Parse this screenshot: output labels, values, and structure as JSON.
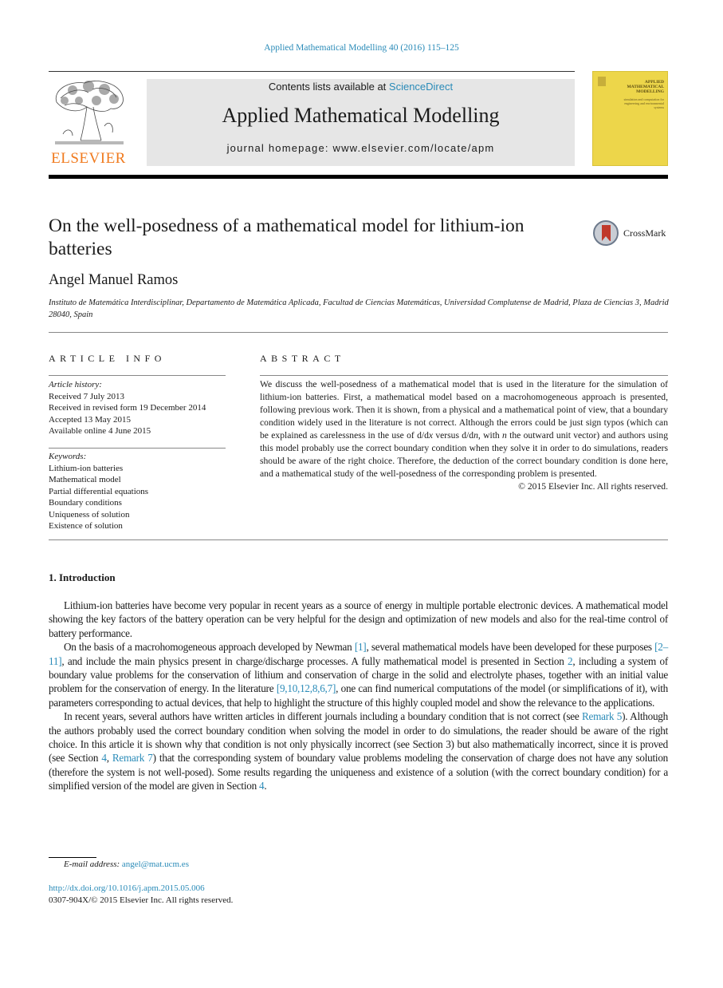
{
  "header": {
    "journal_reference": "Applied Mathematical Modelling 40 (2016) 115–125",
    "contents_prefix": "Contents lists available at ",
    "contents_link": "ScienceDirect",
    "journal_title": "Applied Mathematical Modelling",
    "homepage_line": "journal homepage: www.elsevier.com/locate/apm",
    "publisher_logo_text": "ELSEVIER",
    "cover_title": "APPLIED MATHEMATICAL MODELLING",
    "cover_subtitle": "simulation and computation for engineering and environmental systems",
    "brand_color": "#f07a1e",
    "link_color": "#2a8bb8",
    "cover_color": "#edd64a"
  },
  "article": {
    "title": "On the well-posedness of a mathematical model for lithium-ion batteries",
    "crossmark_label": "CrossMark",
    "author": "Angel Manuel Ramos",
    "affiliation": "Instituto de Matemática Interdisciplinar, Departamento de Matemática Aplicada, Facultad de Ciencias Matemáticas, Universidad Complutense de Madrid, Plaza de Ciencias 3, Madrid 28040, Spain"
  },
  "article_info": {
    "heading": "ARTICLE INFO",
    "history_label": "Article history:",
    "history": [
      "Received 7 July 2013",
      "Received in revised form 19 December 2014",
      "Accepted 13 May 2015",
      "Available online 4 June 2015"
    ],
    "keywords_label": "Keywords:",
    "keywords": [
      "Lithium-ion batteries",
      "Mathematical model",
      "Partial differential equations",
      "Boundary conditions",
      "Uniqueness of solution",
      "Existence of solution"
    ]
  },
  "abstract": {
    "heading": "ABSTRACT",
    "text_1": "We discuss the well-posedness of a mathematical model that is used in the literature for the simulation of lithium-ion batteries. First, a mathematical model based on a macrohomogeneous approach is presented, following previous work. Then it is shown, from a physical and a mathematical point of view, that a boundary condition widely used in the literature is not correct. Although the errors could be just sign typos (which can be explained as carelessness in the use of d/d",
    "var_x": "x",
    "text_2": " versus d/d",
    "var_n": "n",
    "text_3": ", with ",
    "var_n2": "n",
    "text_4": " the outward unit vector) and authors using this model probably use the correct boundary condition when they solve it in order to do simulations, readers should be aware of the right choice. Therefore, the deduction of the correct boundary condition is done here, and a mathematical study of the well-posedness of the corresponding problem is presented.",
    "copyright": "© 2015 Elsevier Inc. All rights reserved."
  },
  "introduction": {
    "heading": "1. Introduction",
    "p1": "Lithium-ion batteries have become very popular in recent years as a source of energy in multiple portable electronic devices. A mathematical model showing the key factors of the battery operation can be very helpful for the design and optimization of new models and also for the real-time control of battery performance.",
    "p2_a": "On the basis of a macrohomogeneous approach developed by Newman ",
    "p2_ref1": "[1]",
    "p2_b": ", several mathematical models have been developed for these purposes ",
    "p2_ref2": "[2–11]",
    "p2_c": ", and include the main physics present in charge/discharge processes. A fully mathematical model is presented in Section ",
    "p2_ref3": "2",
    "p2_d": ", including a system of boundary value problems for the conservation of lithium and conservation of charge in the solid and electrolyte phases, together with an initial value problem for the conservation of energy. In the literature ",
    "p2_ref4": "[9,10,12,8,6,7]",
    "p2_e": ", one can find numerical computations of the model (or simplifications of it), with parameters corresponding to actual devices, that help to highlight the structure of this highly coupled model and show the relevance to the applications.",
    "p3_a": "In recent years, several authors have written articles in different journals including a boundary condition that is not correct (see ",
    "p3_ref1": "Remark 5",
    "p3_b": "). Although the authors probably used the correct boundary condition when solving the model in order to do simulations, the reader should be aware of the right choice. In this article it is shown why that condition is not only physically incorrect (see Section 3) but also mathematically incorrect, since it is proved (see Section ",
    "p3_ref2": "4",
    "p3_c": ", ",
    "p3_ref3": "Remark 7",
    "p3_d": ") that the corresponding system of boundary value problems modeling the conservation of charge does not have any solution (therefore the system is not well-posed). Some results regarding the uniqueness and existence of a solution (with the correct boundary condition) for a simplified version of the model are given in Section ",
    "p3_ref4": "4",
    "p3_e": "."
  },
  "footer": {
    "email_label": "E-mail address: ",
    "email": "angel@mat.ucm.es",
    "doi": "http://dx.doi.org/10.1016/j.apm.2015.05.006",
    "issn_line": "0307-904X/© 2015 Elsevier Inc. All rights reserved."
  }
}
